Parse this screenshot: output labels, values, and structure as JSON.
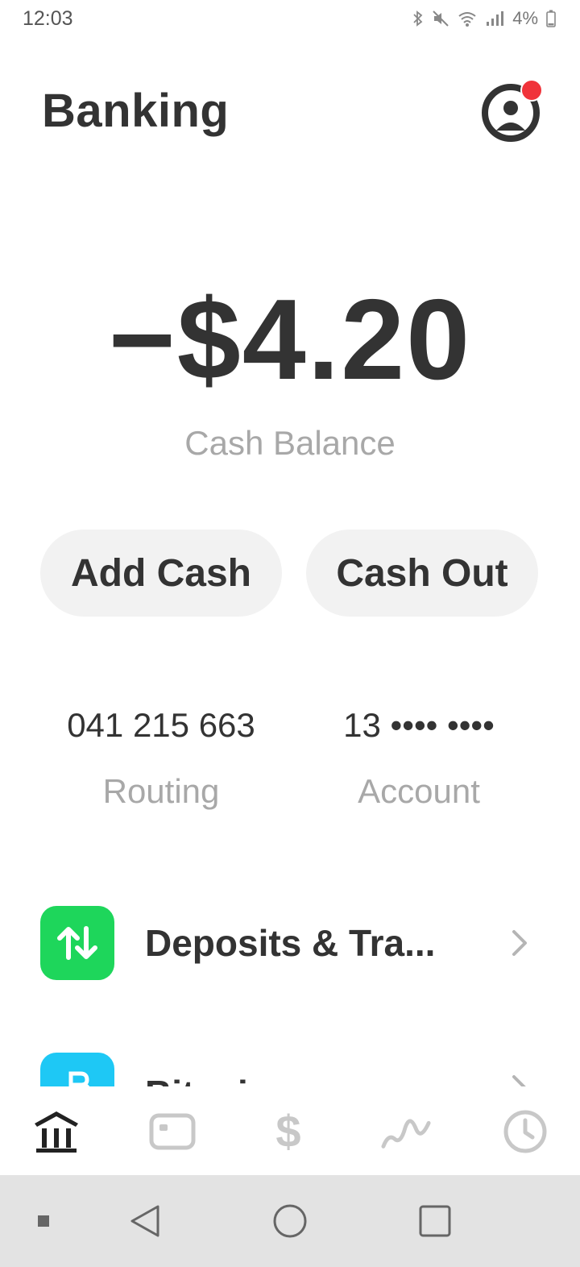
{
  "status_bar": {
    "time": "12:03",
    "battery": "4%",
    "icons": [
      "bluetooth-icon",
      "mute-icon",
      "wifi-icon",
      "signal-icon",
      "battery-icon"
    ]
  },
  "header": {
    "title": "Banking",
    "profile_icon": "profile-icon",
    "notification_badge_color": "#f0333a"
  },
  "balance": {
    "amount": "−$4.20",
    "label": "Cash Balance"
  },
  "actions": {
    "add_cash": "Add Cash",
    "cash_out": "Cash Out"
  },
  "account_info": {
    "routing_number": "041 215 663",
    "routing_label": "Routing",
    "account_number": "13 •••• ••••",
    "account_label": "Account"
  },
  "list": [
    {
      "label": "Deposits & Tra...",
      "icon": "transfer-arrows-icon",
      "icon_color": "#1ed65b"
    },
    {
      "label": "Bitcoin",
      "icon": "bitcoin-icon",
      "icon_color": "#1ec8f5"
    }
  ],
  "tab_bar": {
    "tabs": [
      "banking-tab-icon",
      "card-tab-icon",
      "cash-tab-icon",
      "investing-tab-icon",
      "activity-tab-icon"
    ],
    "cash_glyph": "$",
    "active": "banking"
  },
  "nav_bar": {
    "buttons": [
      "dot",
      "back",
      "home",
      "recent"
    ]
  }
}
